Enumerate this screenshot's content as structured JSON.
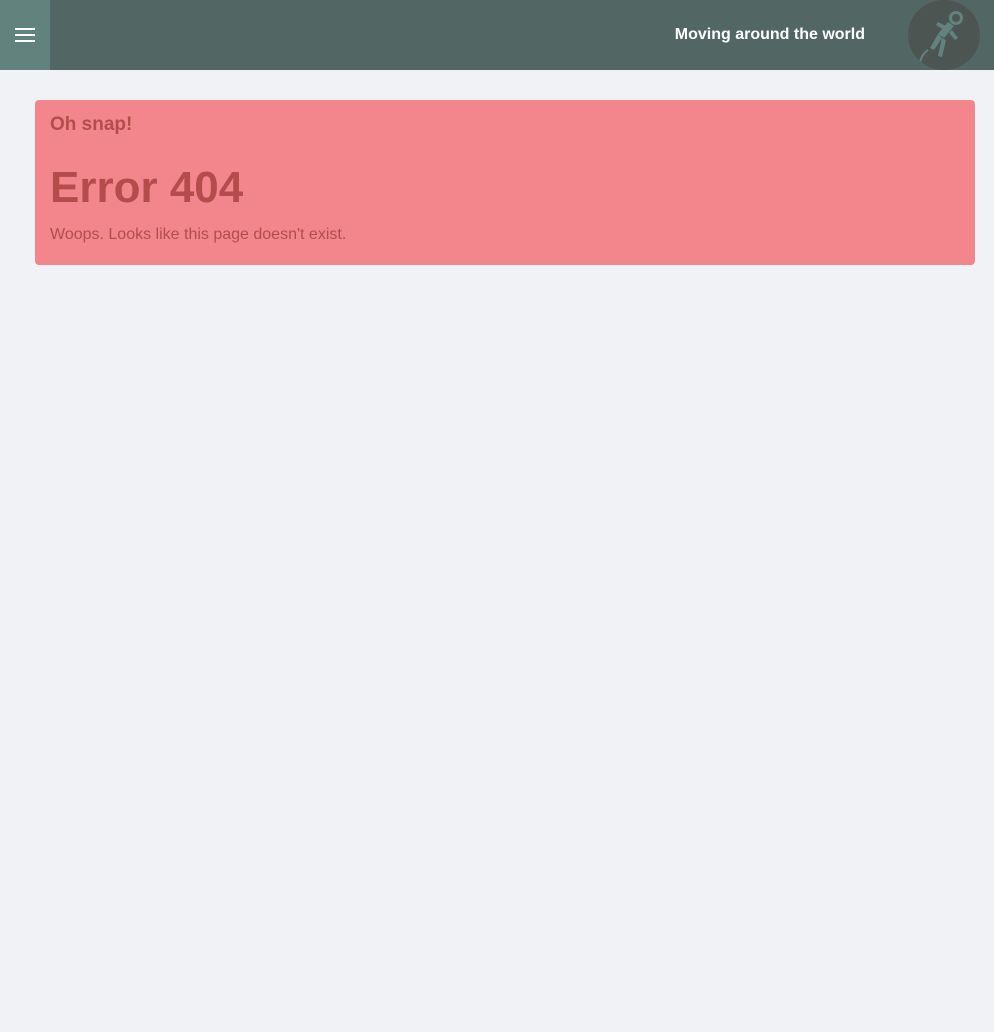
{
  "header": {
    "menu_icon": "hamburger-menu-icon",
    "site_title": "Moving around the world",
    "avatar_icon": "astronaut-icon",
    "bar_color": "#526763",
    "menu_button_color": "#62827d"
  },
  "alert": {
    "heading": "Oh snap!",
    "title": "Error 404",
    "message": "Woops. Looks like this page doesn't exist.",
    "background_color": "#f3858d",
    "text_color": "#b54c4c"
  },
  "page": {
    "background_color": "#f0f2f5"
  }
}
